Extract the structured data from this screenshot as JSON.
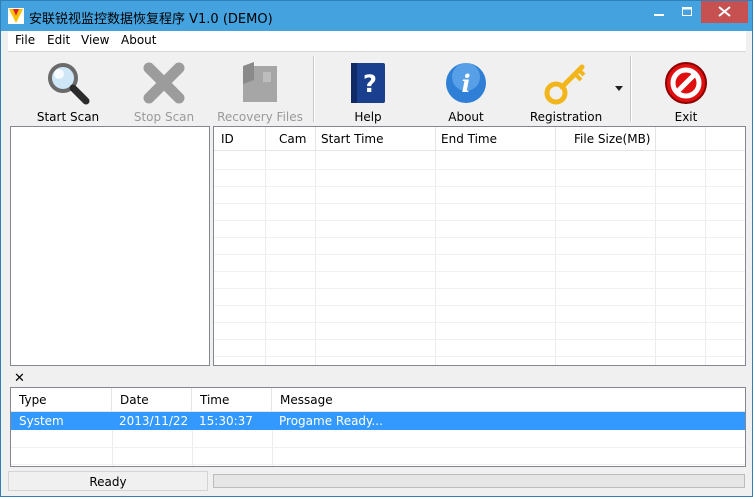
{
  "window": {
    "title": "安联锐视监控数据恢复程序 V1.0 (DEMO)",
    "controls": {
      "minimize": "—",
      "maximize": "☐",
      "close": "✕"
    }
  },
  "menu": [
    "File",
    "Edit",
    "View",
    "About"
  ],
  "toolbar": {
    "start_scan": "Start Scan",
    "stop_scan": "Stop Scan",
    "recovery_files": "Recovery  Files",
    "help": "Help",
    "about": "About",
    "registration": "Registration",
    "exit": "Exit"
  },
  "file_table": {
    "columns": [
      "ID",
      "Cam",
      "Start Time",
      "End Time",
      "File Size(MB)"
    ]
  },
  "log_panel": {
    "close_glyph": "✕",
    "columns": [
      "Type",
      "Date",
      "Time",
      "Message"
    ],
    "rows": [
      {
        "type": "System",
        "date": "2013/11/22",
        "time": "15:30:37",
        "message": "Progame Ready..."
      }
    ]
  },
  "status": {
    "text": "Ready",
    "progress": 0
  },
  "colors": {
    "titlebar": "#44a2df",
    "close_button": "#c75050",
    "selection": "#3399ff"
  }
}
